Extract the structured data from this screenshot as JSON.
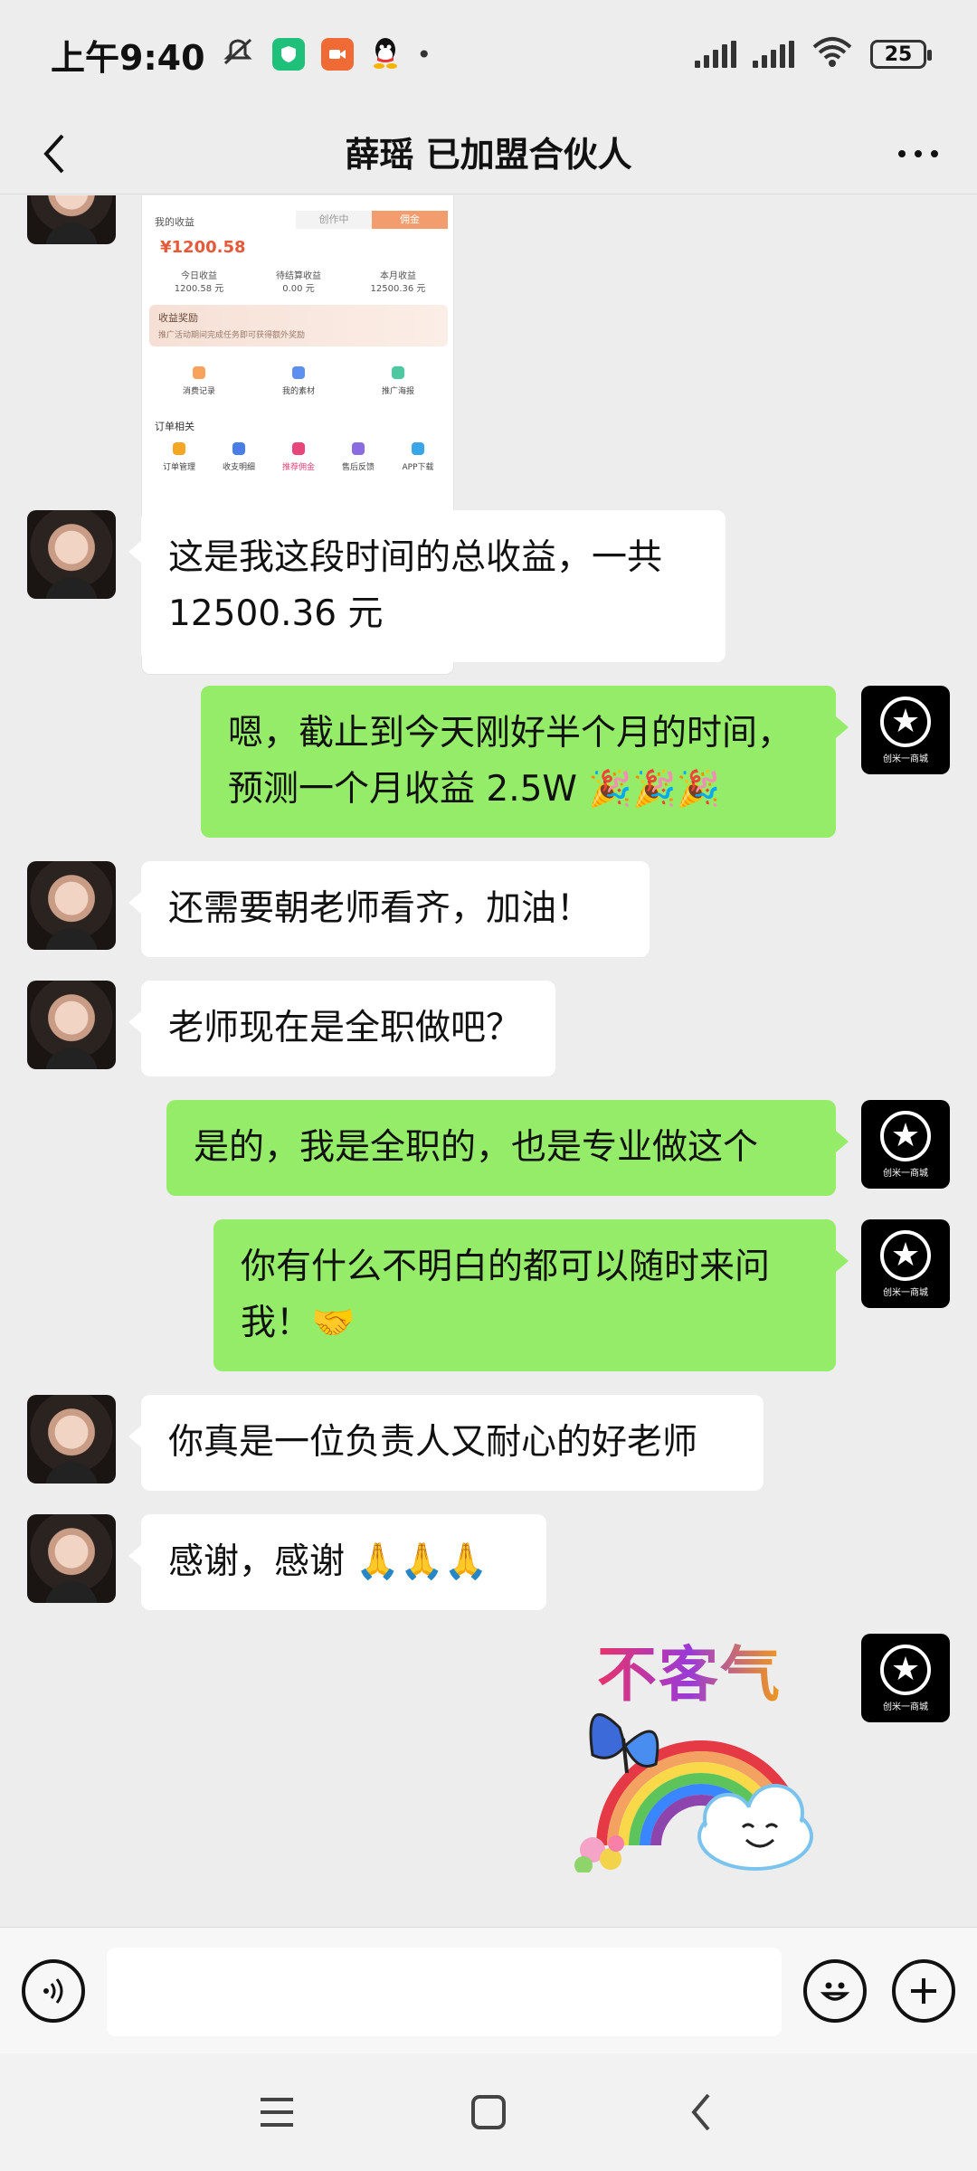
{
  "status_bar": {
    "time": "上午9:40",
    "battery": "25",
    "signal_sub": "6"
  },
  "header": {
    "title": "薛瑶 已加盟合伙人"
  },
  "shared_image": {
    "tabs": [
      "创作中",
      "佣金"
    ],
    "label_income": "我的收益",
    "amount": "¥1200.58",
    "stats": [
      {
        "label": "今日收益",
        "value": "1200.58 元"
      },
      {
        "label": "待结算收益",
        "value": "0.00 元"
      },
      {
        "label": "本月收益",
        "value": "12500.36 元"
      }
    ],
    "banner_title": "收益奖励",
    "banner_sub": "推广活动期间完成任务即可获得额外奖励",
    "grid3": [
      "消费记录",
      "我的素材",
      "推广海报"
    ],
    "section": "订单相关",
    "grid5": [
      "订单管理",
      "收支明细",
      "推荐佣金",
      "售后反馈",
      "APP下载"
    ]
  },
  "messages": [
    {
      "side": "left",
      "text": "这是我这段时间的总收益，一共"
    },
    {
      "side": "left",
      "text": "12500.36 元"
    },
    {
      "side": "right",
      "text": "嗯，截止到今天刚好半个月的时间，"
    },
    {
      "side": "right",
      "text": "预测一个月收益 2.5W 🎉🎉🎉"
    },
    {
      "side": "left",
      "text": "还需要朝老师看齐，加油！"
    },
    {
      "side": "left",
      "text": "老师现在是全职做吧？"
    },
    {
      "side": "right",
      "text": "是的，我是全职的，也是专业做这个"
    },
    {
      "side": "right",
      "text": "你有什么不明白的都可以随时来问"
    },
    {
      "side": "right",
      "text": "我！🤝"
    },
    {
      "side": "left",
      "text": "你真是一位负责人又耐心的好老师"
    },
    {
      "side": "left",
      "text": "感谢，感谢 🙏🙏🙏"
    }
  ],
  "my_avatar_caption": "创米一商城",
  "sticker_text": "不客气",
  "input": {
    "placeholder": ""
  },
  "colors": {
    "background": "#ededed",
    "bubble_right": "#95ec69",
    "bubble_left": "#ffffff"
  }
}
